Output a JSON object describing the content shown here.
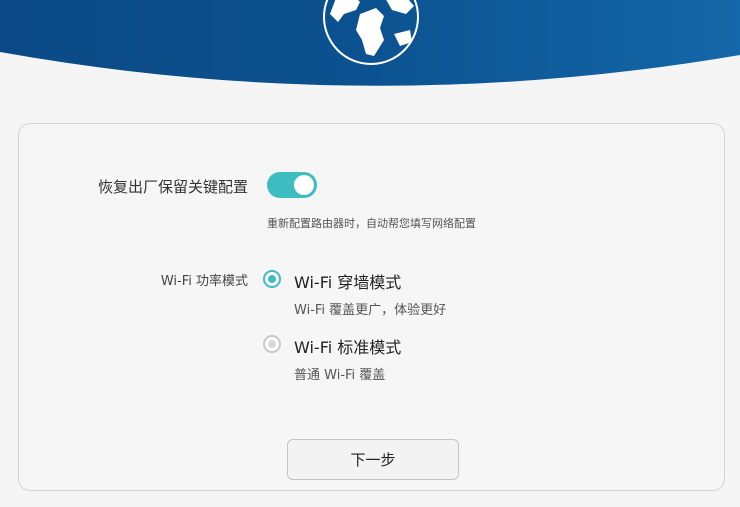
{
  "header": {
    "icon": "globe-icon",
    "colors": {
      "banner_dark": "#0b4a86",
      "banner_light": "#1467a8"
    }
  },
  "settings": {
    "restore_key_config": {
      "label": "恢复出厂保留关键配置",
      "enabled": true,
      "hint": "重新配置路由器时，自动帮您填写网络配置",
      "accent_color": "#3ebdc0"
    },
    "wifi_power_mode": {
      "label": "Wi-Fi 功率模式",
      "options": [
        {
          "title": "Wi-Fi 穿墙模式",
          "description": "Wi-Fi 覆盖更广，体验更好",
          "selected": true
        },
        {
          "title": "Wi-Fi 标准模式",
          "description": "普通 Wi-Fi 覆盖",
          "selected": false
        }
      ]
    }
  },
  "actions": {
    "next_label": "下一步"
  }
}
